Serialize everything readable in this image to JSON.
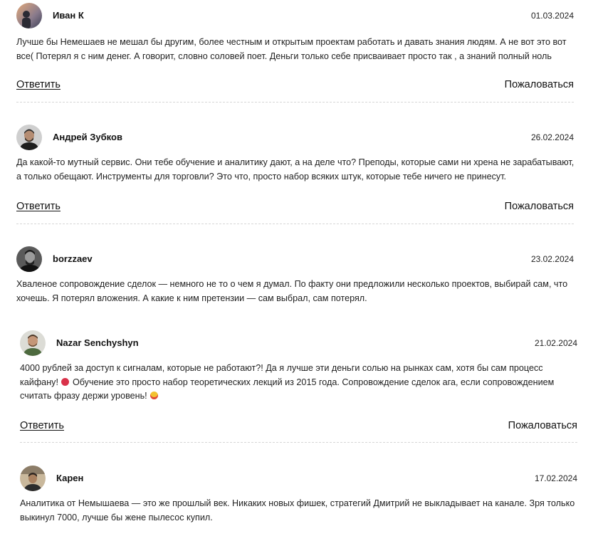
{
  "reviews": [
    {
      "author": "Иван К",
      "date": "01.03.2024",
      "text": "Лучше бы Немешаев не мешал бы другим, более честным и открытым проектам работать и давать знания людям. А не вот это вот все( Потерял я с ним денег. А говорит, словно соловей поет. Деньги только себе присваивает просто так , а знаний полный ноль",
      "reply_label": "Ответить",
      "report_label": "Пожаловаться"
    },
    {
      "author": "Андрей Зубков",
      "date": "26.02.2024",
      "text": "Да какой-то мутный сервис. Они тебе обучение и аналитику дают, а на деле что? Преподы, которые сами ни хрена не зарабатывают, а только обещают. Инструменты для торговли? Это что, просто набор всяких штук, которые тебе ничего не принесут.",
      "reply_label": "Ответить",
      "report_label": "Пожаловаться"
    },
    {
      "author": "borzzaev",
      "date": "23.02.2024",
      "text": "Хваленое сопровождение сделок — немного не то о чем я думал. По факту они предложили несколько проектов, выбирай сам, что хочешь. Я потерял вложения. А какие к ним претензии — сам выбрал, сам потерял."
    },
    {
      "author": "Nazar Senchyshyn",
      "date": "21.02.2024",
      "text_part1": "4000 рублей за доступ к сигналам, которые не работают?! Да я лучше эти деньги солью на рынках сам, хотя бы сам процесс кайфану!",
      "text_part2": "Обучение это просто набор теоретических лекций из 2015 года. Сопровождение сделок ага, если сопровождением считать фразу держи уровень!",
      "emoji_1": "angry-face-emoji",
      "emoji_2": "clown-face-emoji",
      "reply_label": "Ответить",
      "report_label": "Пожаловаться"
    },
    {
      "author": "Карен",
      "date": "17.02.2024",
      "text": "Аналитика от Немышаева — это же прошлый век. Никаких новых фишек, стратегий Дмитрий не выкладывает на канале. Зря только выкинул 7000, лучше бы жене пылесос купил."
    }
  ],
  "colors": {
    "text": "#222222",
    "divider": "#d6d6d6",
    "angry_emoji": "#d9324a",
    "clown_emoji": "#f2c230"
  }
}
